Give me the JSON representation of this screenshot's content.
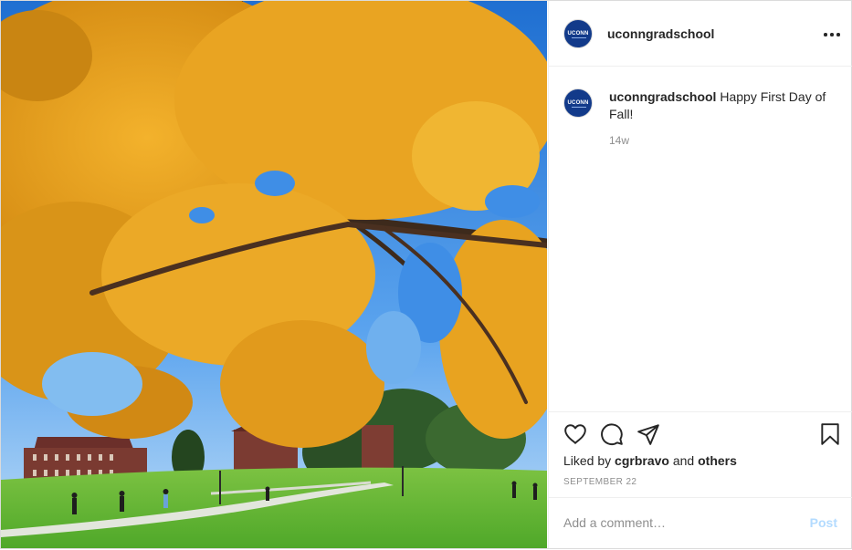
{
  "post": {
    "username": "uconngradschool",
    "avatar_text": "UCONN",
    "caption_user": "uconngradschool",
    "caption_text": "Happy First Day of Fall!",
    "age": "14w",
    "liked_prefix": "Liked by ",
    "liked_user": "cgrbravo",
    "liked_and": " and ",
    "liked_others": "others",
    "date": "SEPTEMBER 22"
  },
  "icons": {
    "more": "more-options-icon",
    "like": "heart-icon",
    "comment": "comment-bubble-icon",
    "share": "paper-plane-icon",
    "save": "bookmark-icon"
  },
  "comment": {
    "placeholder": "Add a comment…",
    "post_label": "Post"
  },
  "colors": {
    "brand_navy": "#123a8a",
    "text": "#262626",
    "muted": "#8e8e8e",
    "post_disabled": "#b3dbff"
  }
}
